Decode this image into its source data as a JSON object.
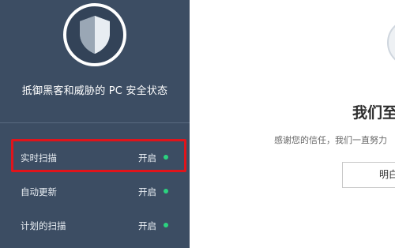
{
  "sidebar": {
    "title": "抵御黑客和威胁的 PC 安全状态",
    "shield_icon": "shield-icon",
    "items": [
      {
        "label": "实时扫描",
        "status": "开启",
        "status_color": "#2bd37f",
        "highlighted": true
      },
      {
        "label": "自动更新",
        "status": "开启",
        "status_color": "#2bd37f",
        "highlighted": false
      },
      {
        "label": "计划的扫描",
        "status": "开启",
        "status_color": "#2bd37f",
        "highlighted": false
      }
    ]
  },
  "main": {
    "title": "我们至",
    "body": "感谢您的信任，我们一直努力",
    "button_label": "明白"
  },
  "colors": {
    "sidebar_bg": "#3c4d63",
    "highlight": "#e0141b",
    "status_on": "#2bd37f"
  }
}
